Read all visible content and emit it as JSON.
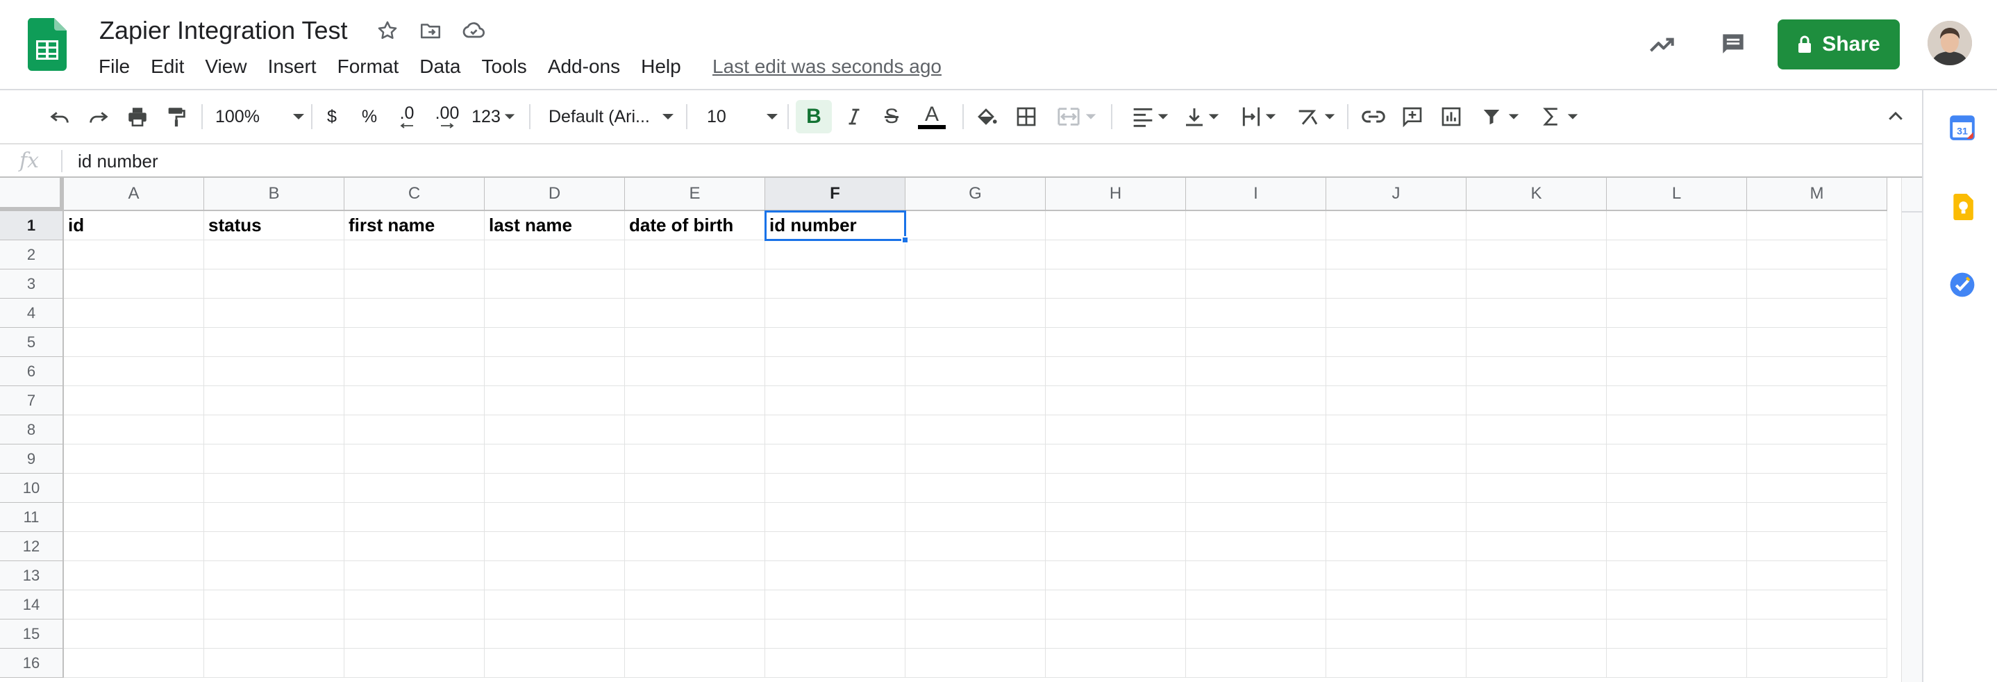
{
  "header": {
    "title": "Zapier Integration Test",
    "menu": [
      "File",
      "Edit",
      "View",
      "Insert",
      "Format",
      "Data",
      "Tools",
      "Add-ons",
      "Help"
    ],
    "last_edit": "Last edit was seconds ago",
    "share_label": "Share"
  },
  "toolbar": {
    "zoom": "100%",
    "currency": "$",
    "percent": "%",
    "decrease_decimal": ".0",
    "increase_decimal": ".00",
    "more_formats": "123",
    "font_family": "Default (Ari...",
    "font_size": "10",
    "bold": "B",
    "strike": "S",
    "text_color": "A"
  },
  "formula_bar": {
    "fx": "fx",
    "value": "id number"
  },
  "sheet": {
    "columns": [
      "A",
      "B",
      "C",
      "D",
      "E",
      "F",
      "G",
      "H",
      "I",
      "J",
      "K",
      "L",
      "M"
    ],
    "rows": [
      "1",
      "2",
      "3",
      "4",
      "5",
      "6",
      "7",
      "8",
      "9",
      "10",
      "11",
      "12",
      "13",
      "14",
      "15",
      "16"
    ],
    "row1": [
      "id",
      "status",
      "first name",
      "last name",
      "date of birth",
      "id number"
    ],
    "selected_cell": "F1"
  },
  "colors": {
    "share_green": "#1e8e3e",
    "selection_blue": "#1a73e8",
    "sheets_green": "#0f9d58"
  },
  "icons": {
    "title": [
      "star-icon",
      "move-to-folder-icon",
      "cloud-saved-icon"
    ],
    "header_right": [
      "activity-trend-icon",
      "comment-icon",
      "lock-icon"
    ],
    "side_panel": [
      "calendar-icon",
      "keep-icon",
      "tasks-icon"
    ]
  }
}
